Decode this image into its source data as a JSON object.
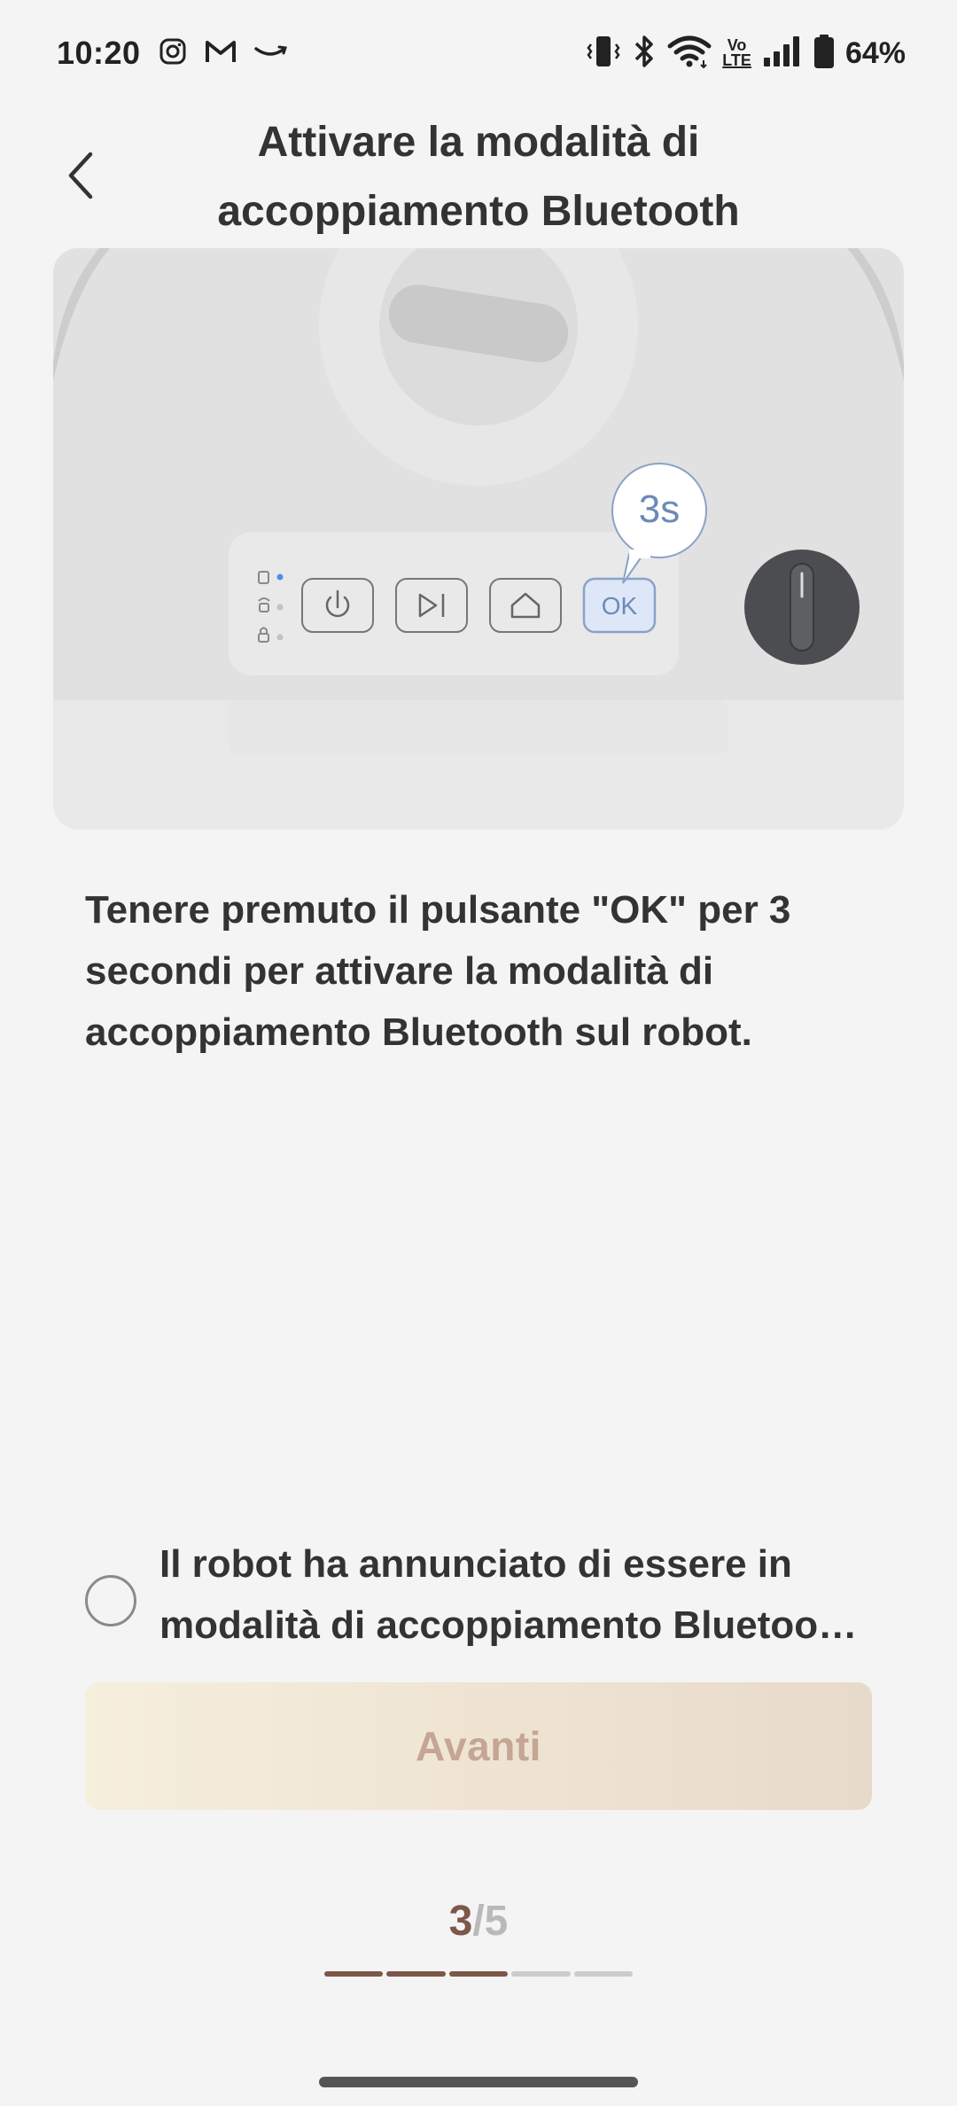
{
  "status_bar": {
    "time": "10:20",
    "battery": "64%",
    "left_icons": [
      "instagram-icon",
      "gmail-icon",
      "amazon-icon"
    ],
    "right_icons": [
      "vibrate-icon",
      "bluetooth-icon",
      "wifi-icon",
      "volte-icon",
      "signal-icon",
      "battery-icon"
    ],
    "volte_label_top": "Vo",
    "volte_label_bottom": "LTE"
  },
  "header": {
    "title": "Attivare la modalità di accoppiamento Bluetooth"
  },
  "illustration": {
    "callout_text": "3s",
    "ok_button_label": "OK",
    "buttons": [
      "power",
      "play",
      "home",
      "OK"
    ],
    "highlight_color": "#dde7f7",
    "highlight_stroke": "#8aa2c8"
  },
  "instruction": {
    "text": "Tenere premuto il pulsante \"OK\" per 3 secondi per attivare la modalità di accoppiamento Bluetooth sul robot."
  },
  "confirmation": {
    "text": "Il robot ha annunciato di essere in modalità di accoppiamento Bluetoo…",
    "checked": false
  },
  "next_button": {
    "label": "Avanti",
    "enabled": false
  },
  "stepper": {
    "current": "3",
    "separator": "/",
    "total": "5",
    "active_color": "#7d5748",
    "inactive_color": "#cccccc"
  },
  "colors": {
    "background": "#f4f4f4",
    "text": "#333333",
    "accent_brown": "#7d5748"
  }
}
